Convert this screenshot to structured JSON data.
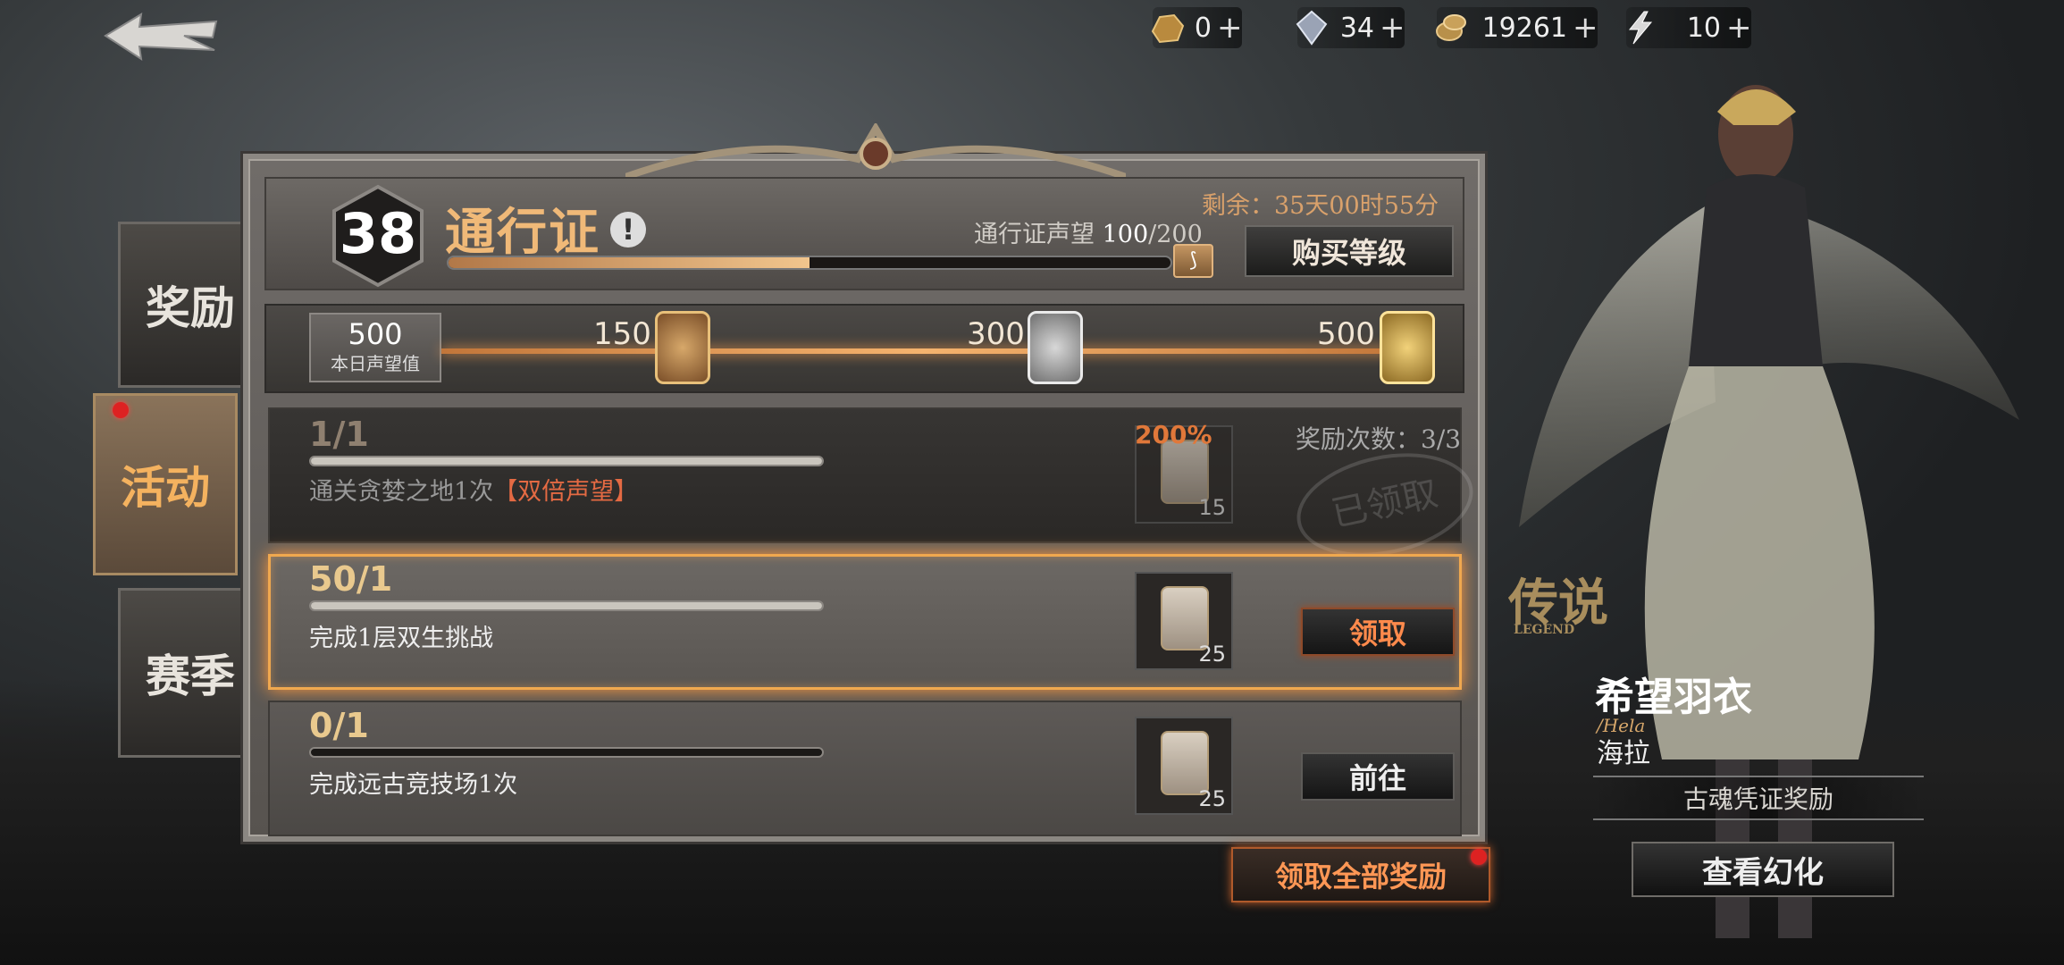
{
  "topbar": {
    "resources": [
      {
        "icon": "gold-ore-icon",
        "value": "0",
        "plus": "+"
      },
      {
        "icon": "crystal-icon",
        "value": "34",
        "plus": "+"
      },
      {
        "icon": "gold-coins-icon",
        "value": "19261",
        "plus": "+"
      },
      {
        "icon": "stamina-lightning-icon",
        "value": "10",
        "plus": "+"
      }
    ]
  },
  "tabs": [
    {
      "label": "奖励"
    },
    {
      "label": "活动"
    },
    {
      "label": "赛季"
    }
  ],
  "pass": {
    "level": "38",
    "title": "通行证",
    "info": "!",
    "remaining": "剩余：35天00时55分",
    "reputation_label": "通行证声望",
    "reputation_current": "100",
    "reputation_max": "/200",
    "reputation_progress": 0.5,
    "buy_level": "购买等级"
  },
  "daily": {
    "value": "500",
    "label": "本日声望值",
    "milestones": [
      "150",
      "300",
      "500"
    ],
    "progress": 1.0
  },
  "tasks": [
    {
      "progress_text": "1/1",
      "progress": 1.0,
      "desc": "通关贪婪之地1次",
      "highlight": "【双倍声望】",
      "bonus": "200%",
      "qty": "15",
      "count_label": "奖励次数：",
      "count": "3/3",
      "stamp": "已领取"
    },
    {
      "progress_text": "50/1",
      "progress": 1.0,
      "desc": "完成1层双生挑战",
      "qty": "25",
      "button": "领取"
    },
    {
      "progress_text": "0/1",
      "progress": 0.0,
      "desc": "完成远古竞技场1次",
      "qty": "25",
      "button": "前往"
    }
  ],
  "claim_all": "领取全部奖励",
  "character": {
    "rarity": "传说",
    "rarity_en": "LEGEND",
    "name": "希望羽衣",
    "en_name": "/Hela",
    "cn_name": "海拉",
    "reward_label": "古魂凭证奖励",
    "view_button": "查看幻化"
  },
  "colors": {
    "accent": "#f0b978",
    "claim_glow": "#f0a84f",
    "alert": "#d22222"
  }
}
